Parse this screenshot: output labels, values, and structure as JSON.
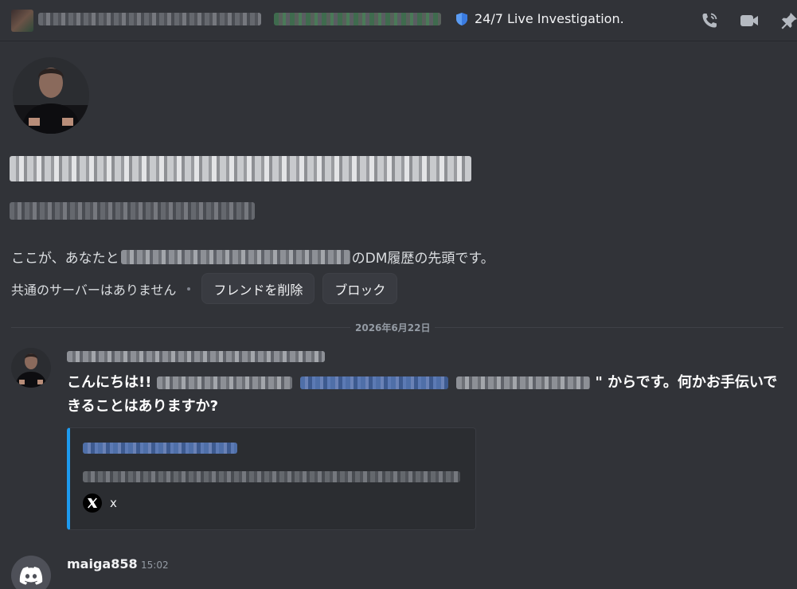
{
  "header": {
    "status_text": "24/7 Live Investigation."
  },
  "intro": {
    "prefix": "ここが、あなたと",
    "suffix": "のDM履歴の先頭です。"
  },
  "profile_actions": {
    "mutual_servers": "共通のサーバーはありません",
    "remove_friend": "フレンドを削除",
    "block": "ブロック"
  },
  "divider": {
    "date": "2026年6月22日"
  },
  "message1": {
    "text_start": "こんにちは!! ",
    "text_end": "\" からです。何かお手伝いできることはありますか?",
    "embed": {
      "provider_icon": "x-logo-icon",
      "provider": "x"
    }
  },
  "message2": {
    "author": "maiga858",
    "time": "15:02"
  },
  "colors": {
    "background": "#313338",
    "embed_accent": "#1d9bf0",
    "button_bg": "#393b41"
  }
}
